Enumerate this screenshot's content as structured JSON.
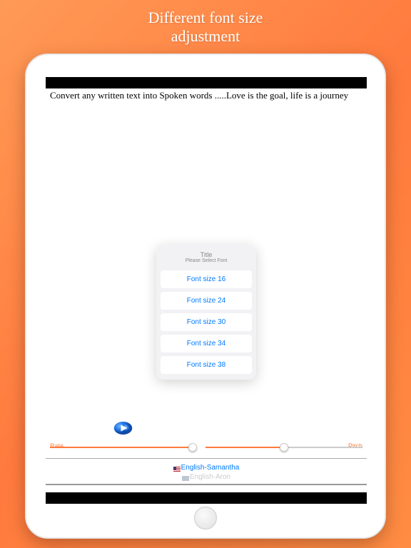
{
  "header": {
    "line1": "Different font size",
    "line2": "adjustment"
  },
  "editor": {
    "text": "Convert any written text into Spoken words .....Love is the goal, life is a journey"
  },
  "popover": {
    "title": "Title",
    "subtitle": "Please Select Font",
    "options": [
      "Font size 16",
      "Font size 24",
      "Font size 30",
      "Font size 34",
      "Font size 38"
    ]
  },
  "sliders": {
    "rate_label": "Rate",
    "pitch_label": "Pitch"
  },
  "voices": {
    "selected": "English-Samantha",
    "next": "English-Aron"
  },
  "colors": {
    "accent": "#ff7a3d",
    "link": "#007aff"
  }
}
